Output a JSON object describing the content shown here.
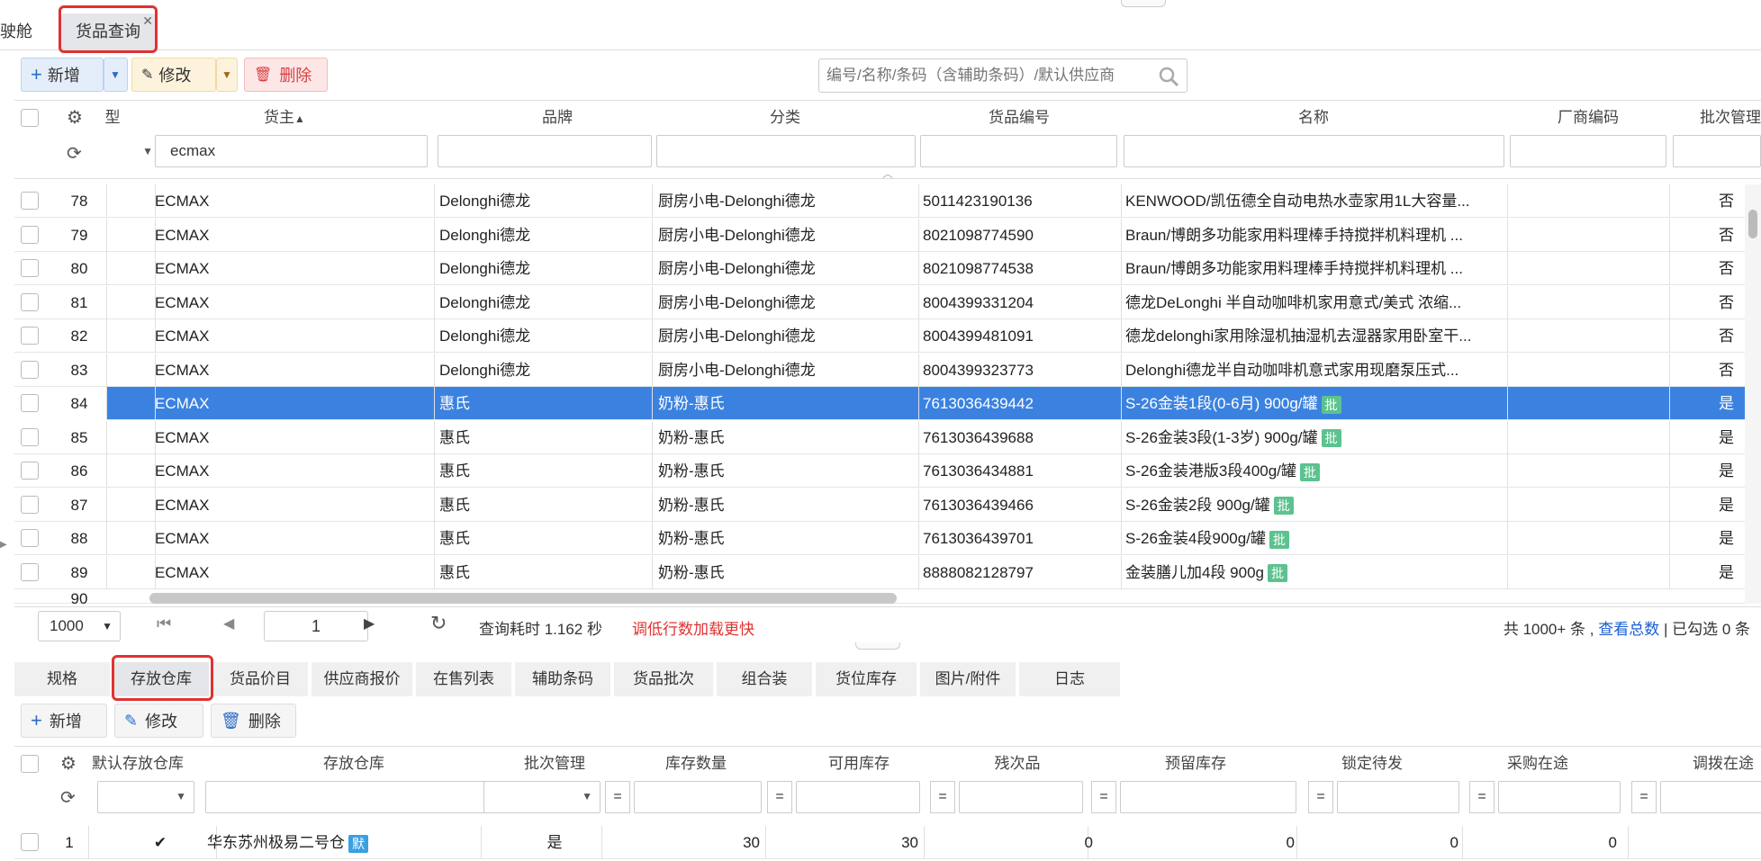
{
  "tabs": {
    "partial": "驶舱",
    "active": "货品查询"
  },
  "toolbar": {
    "add": "新增",
    "edit": "修改",
    "delete": "删除",
    "search_placeholder": "编号/名称/条码（含辅助条码）/默认供应商"
  },
  "grid": {
    "headers": {
      "partial": "型",
      "owner": "货主",
      "brand": "品牌",
      "category": "分类",
      "code": "货品编号",
      "name": "名称",
      "mfr_code": "厂商编码",
      "batch": "批次管理"
    },
    "filter_owner": "ecmax",
    "rows": [
      {
        "no": "78",
        "owner": "ECMAX",
        "brand": "Delonghi德龙",
        "category": "厨房小电-Delonghi德龙",
        "code": "5011423190136",
        "name": "KENWOOD/凯伍德全自动电热水壶家用1L大容量...",
        "badge": "",
        "batch": "否"
      },
      {
        "no": "79",
        "owner": "ECMAX",
        "brand": "Delonghi德龙",
        "category": "厨房小电-Delonghi德龙",
        "code": "8021098774590",
        "name": "Braun/博朗多功能家用料理棒手持搅拌机料理机 ...",
        "badge": "",
        "batch": "否"
      },
      {
        "no": "80",
        "owner": "ECMAX",
        "brand": "Delonghi德龙",
        "category": "厨房小电-Delonghi德龙",
        "code": "8021098774538",
        "name": "Braun/博朗多功能家用料理棒手持搅拌机料理机 ...",
        "badge": "",
        "batch": "否"
      },
      {
        "no": "81",
        "owner": "ECMAX",
        "brand": "Delonghi德龙",
        "category": "厨房小电-Delonghi德龙",
        "code": "8004399331204",
        "name": "德龙DeLonghi 半自动咖啡机家用意式/美式 浓缩...",
        "badge": "",
        "batch": "否"
      },
      {
        "no": "82",
        "owner": "ECMAX",
        "brand": "Delonghi德龙",
        "category": "厨房小电-Delonghi德龙",
        "code": "8004399481091",
        "name": "德龙delonghi家用除湿机抽湿机去湿器家用卧室干...",
        "badge": "",
        "batch": "否"
      },
      {
        "no": "83",
        "owner": "ECMAX",
        "brand": "Delonghi德龙",
        "category": "厨房小电-Delonghi德龙",
        "code": "8004399323773",
        "name": "Delonghi德龙半自动咖啡机意式家用现磨泵压式...",
        "badge": "",
        "batch": "否"
      },
      {
        "no": "84",
        "owner": "ECMAX",
        "brand": "惠氏",
        "category": "奶粉-惠氏",
        "code": "7613036439442",
        "name": "S-26金装1段(0-6月) 900g/罐",
        "badge": "批",
        "batch": "是",
        "selected": true
      },
      {
        "no": "85",
        "owner": "ECMAX",
        "brand": "惠氏",
        "category": "奶粉-惠氏",
        "code": "7613036439688",
        "name": "S-26金装3段(1-3岁) 900g/罐",
        "badge": "批",
        "batch": "是"
      },
      {
        "no": "86",
        "owner": "ECMAX",
        "brand": "惠氏",
        "category": "奶粉-惠氏",
        "code": "7613036434881",
        "name": "S-26金装港版3段400g/罐",
        "badge": "批",
        "batch": "是"
      },
      {
        "no": "87",
        "owner": "ECMAX",
        "brand": "惠氏",
        "category": "奶粉-惠氏",
        "code": "7613036439466",
        "name": "S-26金装2段 900g/罐",
        "badge": "批",
        "batch": "是"
      },
      {
        "no": "88",
        "owner": "ECMAX",
        "brand": "惠氏",
        "category": "奶粉-惠氏",
        "code": "7613036439701",
        "name": "S-26金装4段900g/罐",
        "badge": "批",
        "batch": "是"
      },
      {
        "no": "89",
        "owner": "ECMAX",
        "brand": "惠氏",
        "category": "奶粉-惠氏",
        "code": "8888082128797",
        "name": "金装膳儿加4段 900g",
        "badge": "批",
        "batch": "是"
      }
    ],
    "partial_row_no": "90"
  },
  "pager": {
    "page_size": "1000",
    "page": "1",
    "query_time": "查询耗时 1.162 秒",
    "hint": "调低行数加载更快",
    "total_prefix": "共 1000+ 条 ,",
    "total_link": "查看总数",
    "checked": "| 已勾选 0 条"
  },
  "bottom_tabs": [
    "规格",
    "存放仓库",
    "货品价目",
    "供应商报价",
    "在售列表",
    "辅助条码",
    "货品批次",
    "组合装",
    "货位库存",
    "图片/附件",
    "日志"
  ],
  "sub_toolbar": {
    "add": "新增",
    "edit": "修改",
    "delete": "删除"
  },
  "sub_grid": {
    "headers": {
      "default_wh": "默认存放仓库",
      "warehouse": "存放仓库",
      "batch": "批次管理",
      "stock": "库存数量",
      "available": "可用库存",
      "defective": "残次品",
      "reserved": "预留库存",
      "locked": "锁定待发",
      "purchasing": "采购在途",
      "transfer": "调拨在途"
    },
    "eq": "=",
    "rows": [
      {
        "no": "1",
        "check": "✔",
        "warehouse": "华东苏州极易二号仓",
        "badge": "默",
        "batch": "是",
        "stock": "30",
        "available": "30",
        "defective": "0",
        "reserved": "0",
        "locked": "0",
        "purchasing": "0"
      }
    ]
  }
}
